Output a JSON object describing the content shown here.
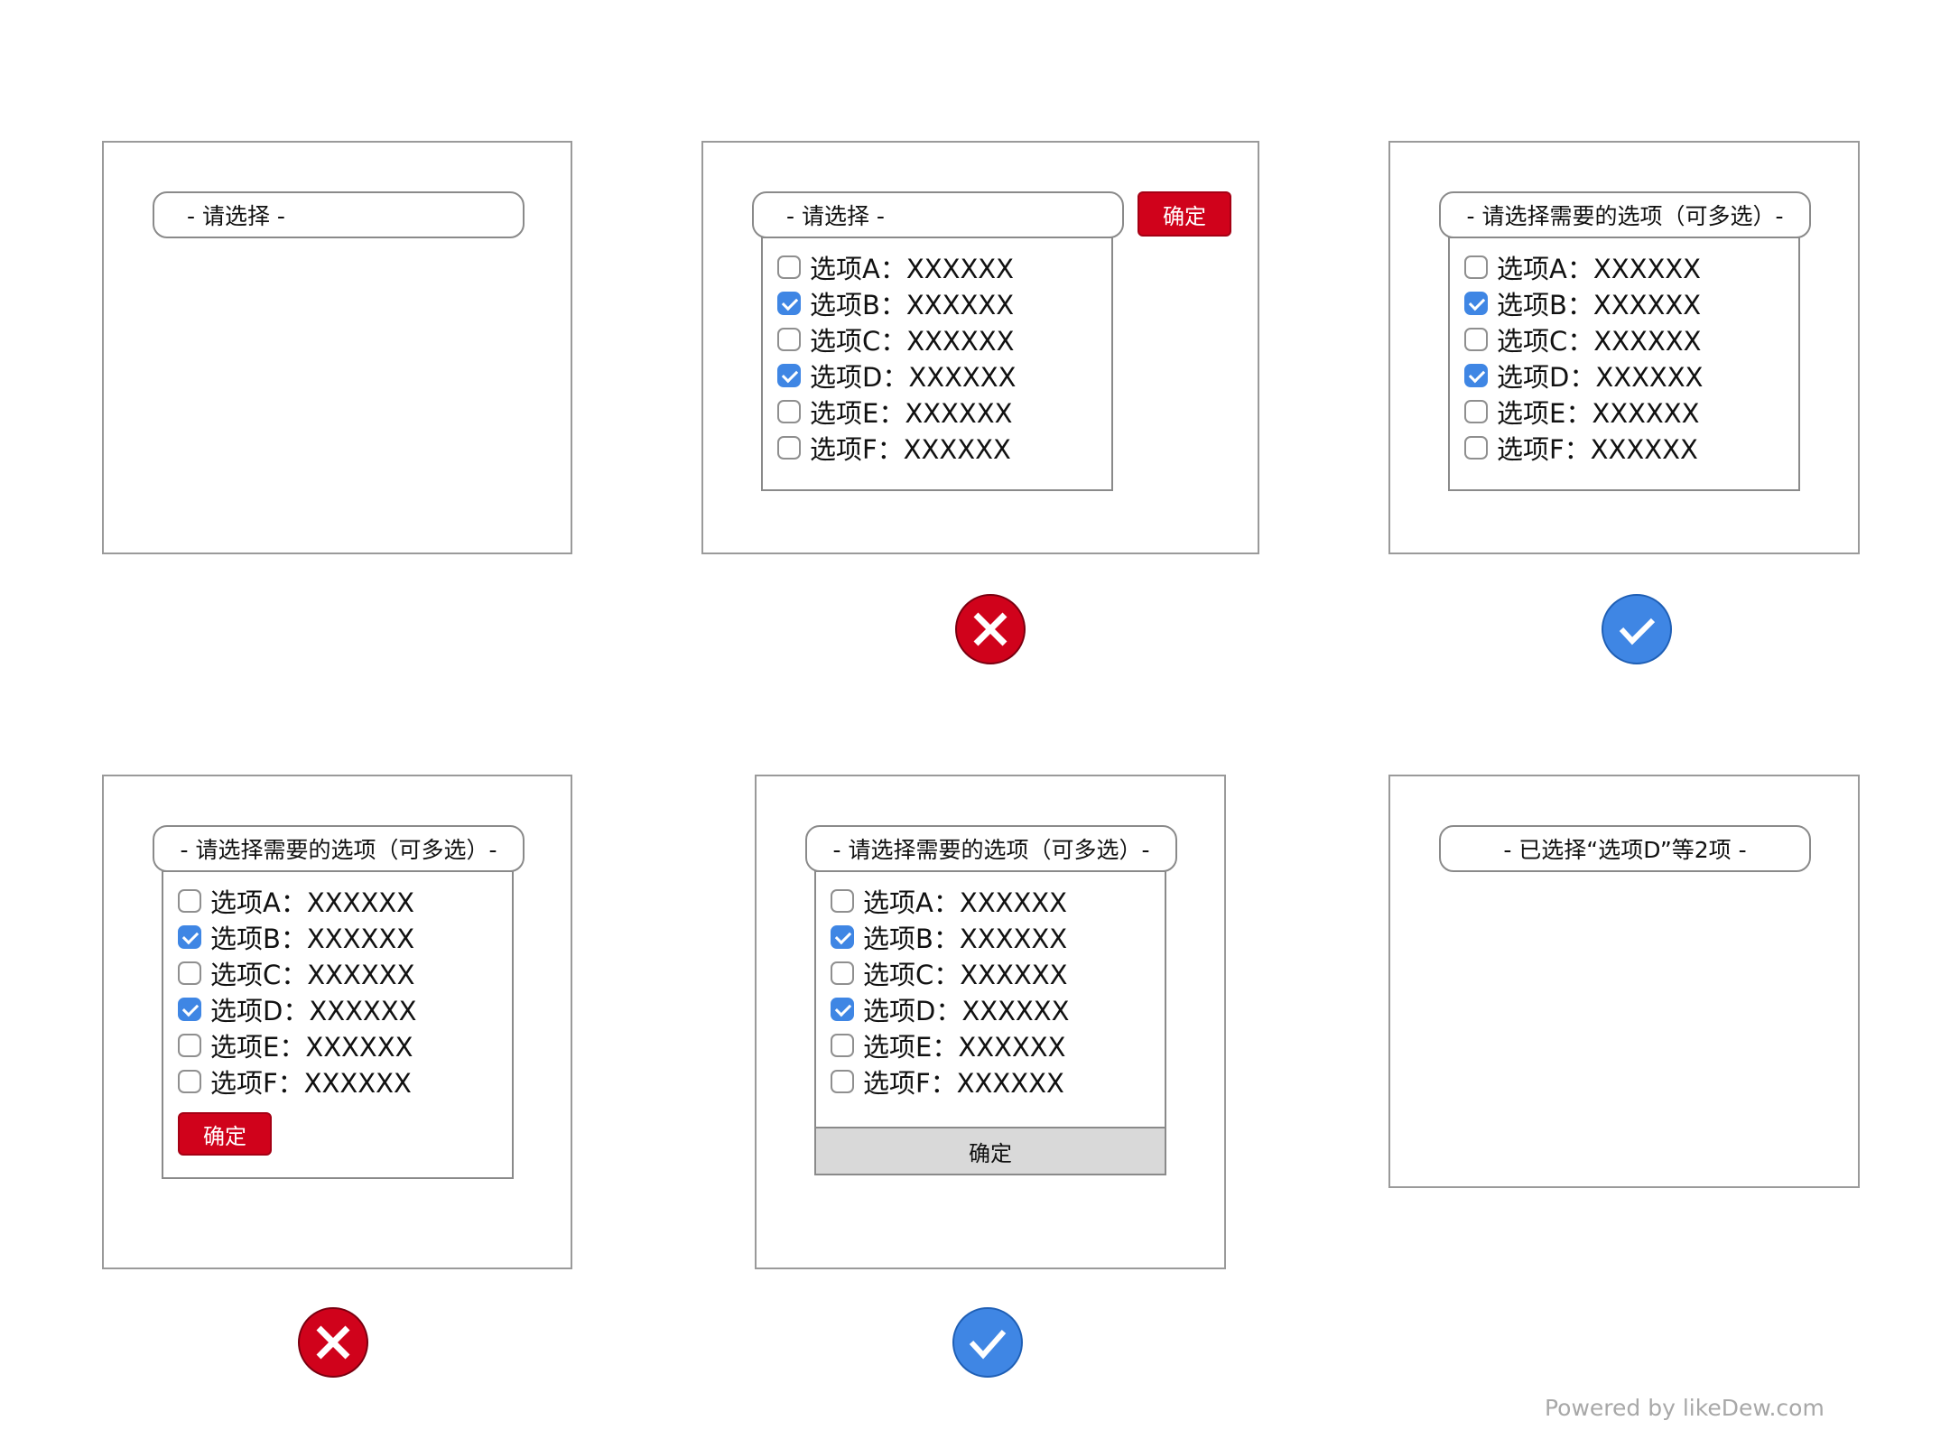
{
  "colors": {
    "danger": "#d0021b",
    "success": "#3f86e4",
    "border": "#9a9a9a",
    "checked": "#3f86e4"
  },
  "icons": {
    "wrong": "red-x-circle-icon",
    "right": "blue-check-circle-icon"
  },
  "footer": "Powered by likeDew.com",
  "panel1": {
    "select": "- 请选择 -"
  },
  "panel2": {
    "select": "- 请选择 -",
    "confirm": "确定",
    "options": [
      {
        "label": "选项A：XXXXXX",
        "checked": false
      },
      {
        "label": "选项B：XXXXXX",
        "checked": true
      },
      {
        "label": "选项C：XXXXXX",
        "checked": false
      },
      {
        "label": "选项D：XXXXXX",
        "checked": true
      },
      {
        "label": "选项E：XXXXXX",
        "checked": false
      },
      {
        "label": "选项F：XXXXXX",
        "checked": false
      }
    ]
  },
  "panel3": {
    "select": "- 请选择需要的选项（可多选）-",
    "options": [
      {
        "label": "选项A：XXXXXX",
        "checked": false
      },
      {
        "label": "选项B：XXXXXX",
        "checked": true
      },
      {
        "label": "选项C：XXXXXX",
        "checked": false
      },
      {
        "label": "选项D：XXXXXX",
        "checked": true
      },
      {
        "label": "选项E：XXXXXX",
        "checked": false
      },
      {
        "label": "选项F：XXXXXX",
        "checked": false
      }
    ]
  },
  "panel4": {
    "select": "- 请选择需要的选项（可多选）-",
    "confirm": "确定",
    "options": [
      {
        "label": "选项A：XXXXXX",
        "checked": false
      },
      {
        "label": "选项B：XXXXXX",
        "checked": true
      },
      {
        "label": "选项C：XXXXXX",
        "checked": false
      },
      {
        "label": "选项D：XXXXXX",
        "checked": true
      },
      {
        "label": "选项E：XXXXXX",
        "checked": false
      },
      {
        "label": "选项F：XXXXXX",
        "checked": false
      }
    ]
  },
  "panel5": {
    "select": "- 请选择需要的选项（可多选）-",
    "confirm": "确定",
    "options": [
      {
        "label": "选项A：XXXXXX",
        "checked": false
      },
      {
        "label": "选项B：XXXXXX",
        "checked": true
      },
      {
        "label": "选项C：XXXXXX",
        "checked": false
      },
      {
        "label": "选项D：XXXXXX",
        "checked": true
      },
      {
        "label": "选项E：XXXXXX",
        "checked": false
      },
      {
        "label": "选项F：XXXXXX",
        "checked": false
      }
    ]
  },
  "panel6": {
    "select": "- 已选择“选项D”等2项 -"
  }
}
